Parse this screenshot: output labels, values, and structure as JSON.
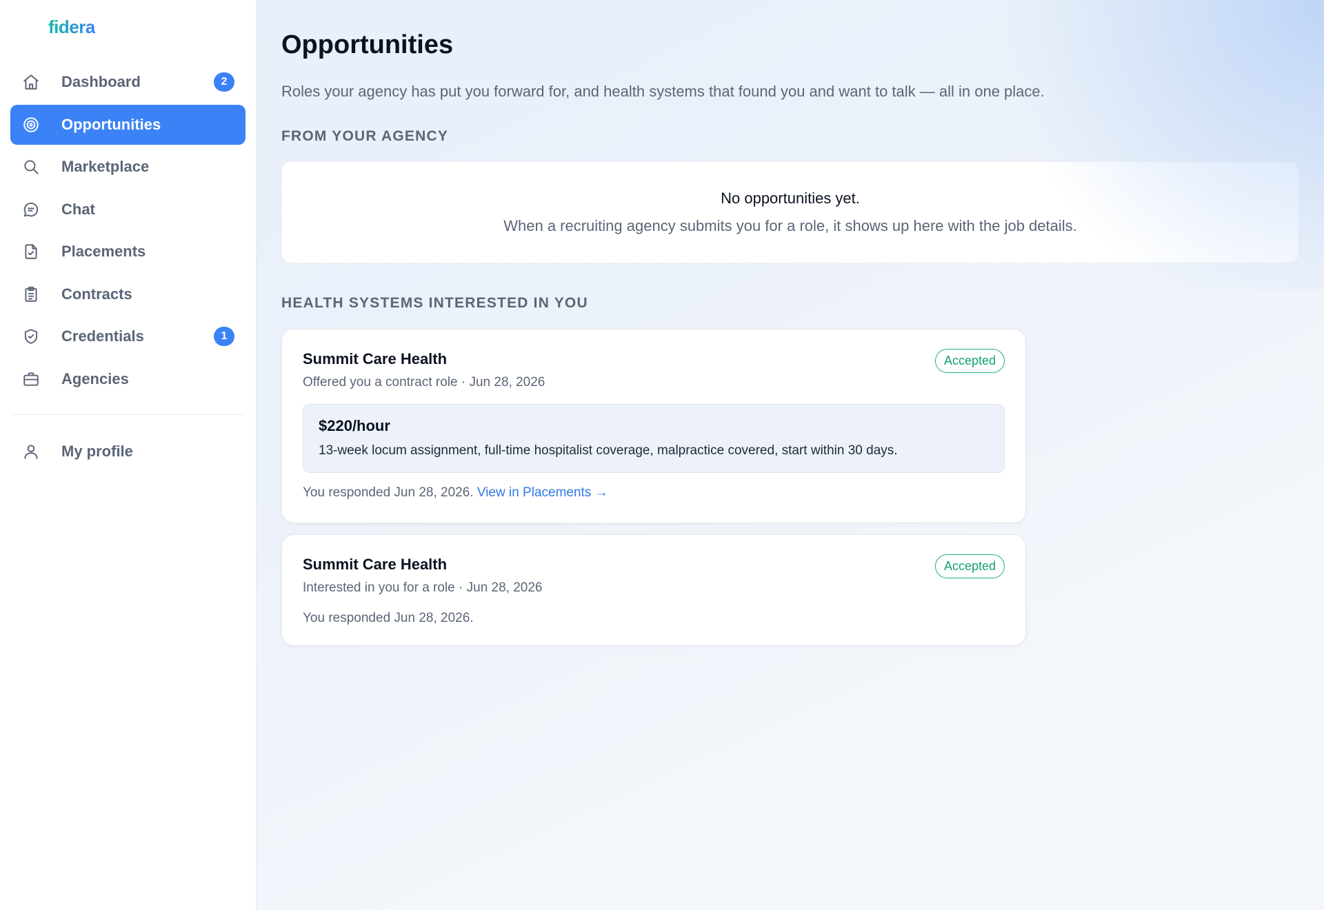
{
  "app": {
    "logo_text": "fidera"
  },
  "sidebar": {
    "items": [
      {
        "label": "Dashboard",
        "icon": "home-icon",
        "badge": "2"
      },
      {
        "label": "Opportunities",
        "icon": "target-icon",
        "active": true
      },
      {
        "label": "Marketplace",
        "icon": "search-icon"
      },
      {
        "label": "Chat",
        "icon": "chat-icon"
      },
      {
        "label": "Placements",
        "icon": "document-check-icon"
      },
      {
        "label": "Contracts",
        "icon": "clipboard-icon"
      },
      {
        "label": "Credentials",
        "icon": "shield-check-icon",
        "badge": "1"
      },
      {
        "label": "Agencies",
        "icon": "briefcase-icon"
      }
    ],
    "profile": {
      "label": "My profile",
      "icon": "user-icon"
    }
  },
  "main": {
    "title": "Opportunities",
    "subtitle": "Roles your agency has put you forward for, and health systems that found you and want to talk — all in one place.",
    "agency_section": {
      "heading": "From your agency",
      "empty_title": "No opportunities yet.",
      "empty_text": "When a recruiting agency submits you for a role, it shows up here with the job details."
    },
    "health_section": {
      "heading": "Health systems interested in you",
      "cards": [
        {
          "org": "Summit Care Health",
          "subtitle": "Offered you a contract role · Jun 28, 2026",
          "status": "Accepted",
          "rate": "$220/hour",
          "description": "13-week locum assignment, full-time hospitalist coverage, malpractice covered, start within 30 days.",
          "footer": "You responded Jun 28, 2026.",
          "link": "View in Placements →"
        },
        {
          "org": "Summit Care Health",
          "subtitle": "Interested in you for a role · Jun 28, 2026",
          "status": "Accepted",
          "footer": "You responded Jun 28, 2026."
        }
      ]
    }
  },
  "colors": {
    "accent": "#3b82f6",
    "success": "#16a06d",
    "muted": "#5b6577"
  }
}
